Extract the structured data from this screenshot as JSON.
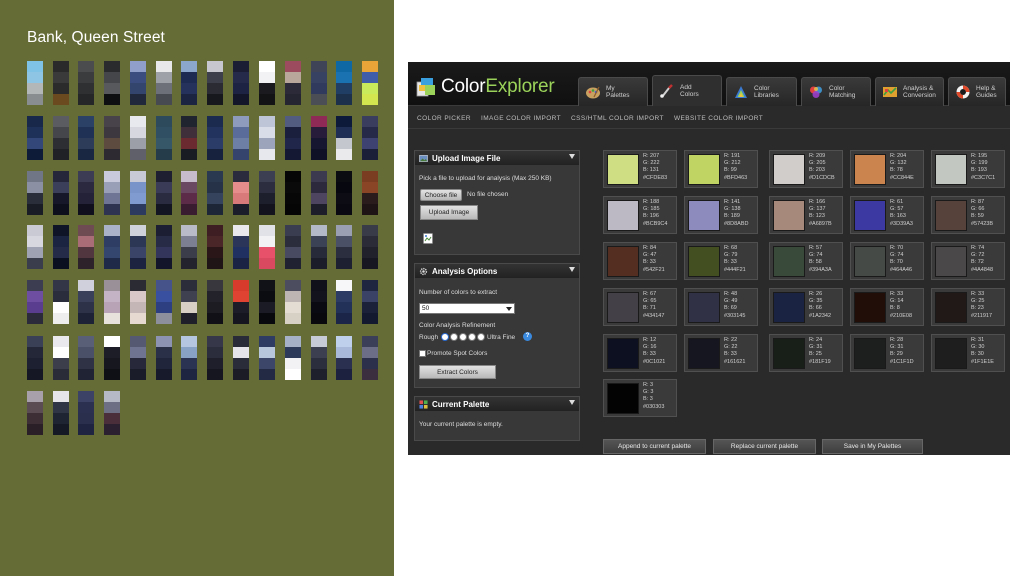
{
  "slide": {
    "title": "Bank, Queen Street",
    "background": "#666c36",
    "swatch_columns": [
      [
        "#7fc3e6",
        "#8fc5e4",
        "#b4b7b8",
        "#8a8d8f"
      ],
      [
        "#2a2a2a",
        "#3a3a3a",
        "#2b2b2b",
        "#6b4a1f"
      ],
      [
        "#4a4c4e",
        "#3b3c3e",
        "#2f3032",
        "#252627"
      ],
      [
        "#2a2b2d",
        "#45464a",
        "#58595c",
        "#0e0f10"
      ],
      [
        "#8f9fc9",
        "#3a4d7e",
        "#34456d",
        "#20283c"
      ],
      [
        "#e8e8ea",
        "#9fa1a8",
        "#6e7079",
        "#484a51"
      ],
      [
        "#8ca7cc",
        "#1d2b52",
        "#25335c",
        "#1b2542"
      ],
      [
        "#c6c7cf",
        "#3d3f4a",
        "#2a2b33",
        "#17181d"
      ],
      [
        "#1a1d33",
        "#252a4a",
        "#1d2342",
        "#131629"
      ],
      [
        "#ffffff",
        "#f2f2f4",
        "#1a1a1f",
        "#131316"
      ],
      [
        "#9c4a5e",
        "#b8a79a",
        "#2c2a38",
        "#252431"
      ],
      [
        "#3f4556",
        "#374161",
        "#2f3a5c",
        "#4b4e55"
      ],
      [
        "#0f68a4",
        "#1b72b0",
        "#203d63",
        "#1c2f4b"
      ],
      [
        "#e9a537",
        "#3f5da8",
        "#c9ea5a",
        "#d4e64f"
      ],
      [
        "#17284a",
        "#1e3158",
        "#334878",
        "#0e1b38"
      ],
      [
        "#5a5c62",
        "#44464c",
        "#2c2e33",
        "#1f2126"
      ],
      [
        "#2b4165",
        "#1f3154",
        "#2d3c58",
        "#1a2742"
      ],
      [
        "#48434b",
        "#3d3840",
        "#5e4b3f",
        "#2e2a31"
      ],
      [
        "#e8e9ee",
        "#d7d8df",
        "#9c9ea8",
        "#5f6069"
      ],
      [
        "#2d4a5c",
        "#304f62",
        "#355767",
        "#253c4a"
      ],
      [
        "#20242e",
        "#3e2f3a",
        "#6a2a30",
        "#1a1c24"
      ],
      [
        "#1b2a4f",
        "#22335e",
        "#2b3c69",
        "#17223f"
      ],
      [
        "#8f9bbd",
        "#5a6d9a",
        "#6e7fa6",
        "#34446c"
      ],
      [
        "#bdc5d6",
        "#d9dde7",
        "#9ba4ba",
        "#e6e8ed"
      ],
      [
        "#525b80",
        "#1b1f3e",
        "#20254a",
        "#151833"
      ],
      [
        "#8e2a55",
        "#271d3b",
        "#171630",
        "#0f1226"
      ],
      [
        "#0d1a3a",
        "#1f2e55",
        "#c5c7cf",
        "#eaeaec"
      ],
      [
        "#3a3d5e",
        "#262a48",
        "#3e4270",
        "#1c1f38"
      ],
      [
        "#707686",
        "#8b90a2",
        "#2a2d3a",
        "#1a1c25"
      ],
      [
        "#25263a",
        "#3c3f5a",
        "#161728",
        "#0e0f1c"
      ],
      [
        "#3d3c55",
        "#2a2940",
        "#232238",
        "#0f0f1e"
      ],
      [
        "#c9cadb",
        "#9a9fb8",
        "#6e7595",
        "#2d3350"
      ],
      [
        "#c8cad6",
        "#7994c8",
        "#7f9bd0",
        "#2c3a60"
      ],
      [
        "#1e1f30",
        "#3a3b56",
        "#2a2b40",
        "#141523"
      ],
      [
        "#c7bccb",
        "#6b4862",
        "#5c2b48",
        "#3a1c31"
      ],
      [
        "#2b3950",
        "#263248",
        "#36435c",
        "#1d2637"
      ],
      [
        "#2a2b3d",
        "#e58c8c",
        "#d97a7a",
        "#1c1d2a"
      ],
      [
        "#3c3e52",
        "#2c2e3f",
        "#1e1f2c",
        "#12131c"
      ],
      [
        "#060606",
        "#0a0a0a",
        "#070707",
        "#050505"
      ],
      [
        "#3c3a4e",
        "#2b293b",
        "#4e4560",
        "#1d1c29"
      ],
      [
        "#0b0b12",
        "#070710",
        "#0d0b14",
        "#0a0810"
      ],
      [
        "#7a3d22",
        "#8a4426",
        "#2a1b1c",
        "#1e1416"
      ],
      [
        "#c9cad3",
        "#d7d8df",
        "#9ea2b2",
        "#3a3e4c"
      ],
      [
        "#0f1426",
        "#1b2440",
        "#232b48",
        "#0b1020"
      ],
      [
        "#6e4a52",
        "#a86d76",
        "#52363f",
        "#2e222a"
      ],
      [
        "#a9b2c9",
        "#2d3d63",
        "#34466e",
        "#1e2a47"
      ],
      [
        "#d0d2db",
        "#2c3655",
        "#3a4468",
        "#1b2340"
      ],
      [
        "#1c1e33",
        "#282b45",
        "#33365a",
        "#13152a"
      ],
      [
        "#b9bbc9",
        "#7c7f91",
        "#3b3d4b",
        "#22232d"
      ],
      [
        "#3e1e22",
        "#4a2629",
        "#2a1619",
        "#1f1416"
      ],
      [
        "#e9e9ed",
        "#2b3459",
        "#203061",
        "#1a2344"
      ],
      [
        "#e1e2e8",
        "#f2f2f4",
        "#e7526a",
        "#d94a60"
      ],
      [
        "#3a3c4f",
        "#2b2d3d",
        "#474a60",
        "#202231"
      ],
      [
        "#b4b9c8",
        "#3c4256",
        "#272a38",
        "#1b1d28"
      ],
      [
        "#9aa0b2",
        "#4a5066",
        "#2a2e3e",
        "#1d2030"
      ],
      [
        "#3a3b49",
        "#2a2b37",
        "#20212b",
        "#161720"
      ],
      [
        "#3d3d52",
        "#6e4ea0",
        "#5b3d8f",
        "#2a2a3a"
      ],
      [
        "#323646",
        "#2a2d3b",
        "#ffffff",
        "#eeeeee"
      ],
      [
        "#cfd0db",
        "#3a3f5a",
        "#2d3249",
        "#1e2236"
      ],
      [
        "#9a9098",
        "#c4b3c5",
        "#b7a3b5",
        "#e8e2dc"
      ],
      [
        "#2a2b33",
        "#d9c8c8",
        "#c4b5b6",
        "#e5d9d2"
      ],
      [
        "#46538a",
        "#3950a0",
        "#2d3f80",
        "#8d8f9d"
      ],
      [
        "#2c2d3a",
        "#3f4050",
        "#d8cfc5",
        "#1e1f28"
      ],
      [
        "#39373e",
        "#23222a",
        "#1d1c23",
        "#111016"
      ],
      [
        "#d83a2b",
        "#e04332",
        "#1b1c28",
        "#14151e"
      ],
      [
        "#111218",
        "#0b0c12",
        "#1a1b24",
        "#08090d"
      ],
      [
        "#4c4d5e",
        "#bcb5b4",
        "#e3ddd3",
        "#d7d0c4"
      ],
      [
        "#0f1019",
        "#12131c",
        "#0a0b12",
        "#08080d"
      ],
      [
        "#f7f7f9",
        "#2b3b63",
        "#223158",
        "#1a2547"
      ],
      [
        "#1e2640",
        "#3a4366",
        "#1a2139",
        "#131a30"
      ],
      [
        "#3a4056",
        "#232737",
        "#1d2030",
        "#151824"
      ],
      [
        "#eaeaee",
        "#ffffff",
        "#3c3e4c",
        "#2a2c38"
      ],
      [
        "#5a5f78",
        "#4b5069",
        "#2f3245",
        "#202333"
      ],
      [
        "#ffffff",
        "#1c1d26",
        "#16171f",
        "#0f1016"
      ],
      [
        "#555a72",
        "#6f7590",
        "#27293a",
        "#1b1c29"
      ],
      [
        "#8d94b3",
        "#2a3048",
        "#20253b",
        "#161a2b"
      ],
      [
        "#b5c6e0",
        "#88a2c6",
        "#2a3352",
        "#1e2540"
      ],
      [
        "#36384a",
        "#2b2d3c",
        "#1e1f2b",
        "#15161f"
      ],
      [
        "#2a2b38",
        "#e4e4ea",
        "#2b2c3a",
        "#1b1c26"
      ],
      [
        "#2e3b62",
        "#b9c7dd",
        "#3b4668",
        "#232a44"
      ],
      [
        "#a6b1c8",
        "#2d3a5a",
        "#f2f2f4",
        "#ffffff"
      ],
      [
        "#c7cbd8",
        "#3b3f50",
        "#2b2e3c",
        "#1e202b"
      ],
      [
        "#bfd0ec",
        "#a9b9d9",
        "#2a3150",
        "#1c2140"
      ],
      [
        "#3c3f58",
        "#6b6e86",
        "#2d304b",
        "#3b2e3f"
      ],
      [
        "#a8a0ab",
        "#5b4b52",
        "#3d2e36",
        "#2a1f26"
      ],
      [
        "#e6e6ea",
        "#2f3545",
        "#1f2432",
        "#151925"
      ],
      [
        "#3c4266",
        "#2b3050",
        "#2a2f4d",
        "#1f2440"
      ],
      [
        "#b5b8c5",
        "#6d7085",
        "#4a2f3a",
        "#2a2030"
      ]
    ]
  },
  "app": {
    "logo": {
      "part1": "Color",
      "part2": "Explorer"
    },
    "tabs": [
      {
        "label": "My\nPalettes",
        "icon": "palette-icon",
        "active": false
      },
      {
        "label": "Add\nColors",
        "icon": "brush-icon",
        "active": true
      },
      {
        "label": "Color\nLibraries",
        "icon": "library-icon",
        "active": false
      },
      {
        "label": "Color\nMatching",
        "icon": "color-wheel-icon",
        "active": false
      },
      {
        "label": "Analysis &\nConversion",
        "icon": "analysis-icon",
        "active": false
      },
      {
        "label": "Help &\nGuides",
        "icon": "lifebuoy-icon",
        "active": false
      }
    ],
    "subnav": [
      "COLOR PICKER",
      "IMAGE COLOR IMPORT",
      "CSS/HTML COLOR IMPORT",
      "WEBSITE COLOR IMPORT"
    ],
    "upload_panel": {
      "title": "Upload Image File",
      "instructions": "Pick a file to upload for analysis (Max 250 KB)",
      "choose_file": "Choose file",
      "no_file": "No file chosen",
      "upload_button": "Upload Image"
    },
    "analysis_panel": {
      "title": "Analysis Options",
      "colors_label": "Number of colors to extract",
      "colors_value": "50",
      "refinement_label": "Color Analysis Refinement",
      "rough": "Rough",
      "ultra_fine": "Ultra Fine",
      "promote_label": "Promote Spot Colors",
      "extract_button": "Extract Colors"
    },
    "palette_panel": {
      "title": "Current Palette",
      "empty_text": "Your current palette is empty."
    },
    "colors": [
      {
        "r": "R: 207",
        "g": "G: 222",
        "b": "B: 131",
        "hex": "#CFDE83",
        "color": "#cfde83"
      },
      {
        "r": "R: 191",
        "g": "G: 212",
        "b": "B: 99",
        "hex": "#BFD463",
        "color": "#bfd463"
      },
      {
        "r": "R: 209",
        "g": "G: 205",
        "b": "B: 203",
        "hex": "#D1CDCB",
        "color": "#d1cdcb"
      },
      {
        "r": "R: 204",
        "g": "G: 132",
        "b": "B: 78",
        "hex": "#CC844E",
        "color": "#cc844e"
      },
      {
        "r": "R: 195",
        "g": "G: 199",
        "b": "B: 193",
        "hex": "#C3C7C1",
        "color": "#c3c7c1"
      },
      {
        "r": "R: 188",
        "g": "G: 185",
        "b": "B: 196",
        "hex": "#BCB9C4",
        "color": "#bcb9c4"
      },
      {
        "r": "R: 141",
        "g": "G: 138",
        "b": "B: 189",
        "hex": "#8D8ABD",
        "color": "#8d8abd"
      },
      {
        "r": "R: 166",
        "g": "G: 137",
        "b": "B: 123",
        "hex": "#A6897B",
        "color": "#a6897b"
      },
      {
        "r": "R: 61",
        "g": "G: 57",
        "b": "B: 163",
        "hex": "#3D39A3",
        "color": "#3d39a3"
      },
      {
        "r": "R: 87",
        "g": "G: 66",
        "b": "B: 59",
        "hex": "#57423B",
        "color": "#57423b"
      },
      {
        "r": "R: 84",
        "g": "G: 47",
        "b": "B: 33",
        "hex": "#542F21",
        "color": "#542f21"
      },
      {
        "r": "R: 68",
        "g": "G: 79",
        "b": "B: 33",
        "hex": "#444F21",
        "color": "#444f21"
      },
      {
        "r": "R: 57",
        "g": "G: 74",
        "b": "B: 58",
        "hex": "#394A3A",
        "color": "#394a3a"
      },
      {
        "r": "R: 70",
        "g": "G: 74",
        "b": "B: 70",
        "hex": "#464A46",
        "color": "#464a46"
      },
      {
        "r": "R: 74",
        "g": "G: 72",
        "b": "B: 72",
        "hex": "#4A4848",
        "color": "#4a4848"
      },
      {
        "r": "R: 67",
        "g": "G: 65",
        "b": "B: 71",
        "hex": "#434147",
        "color": "#434147"
      },
      {
        "r": "R: 48",
        "g": "G: 49",
        "b": "B: 69",
        "hex": "#303145",
        "color": "#303145"
      },
      {
        "r": "R: 26",
        "g": "G: 35",
        "b": "B: 66",
        "hex": "#1A2342",
        "color": "#1a2342"
      },
      {
        "r": "R: 33",
        "g": "G: 14",
        "b": "B: 8",
        "hex": "#210E08",
        "color": "#210e08"
      },
      {
        "r": "R: 33",
        "g": "G: 25",
        "b": "B: 23",
        "hex": "#211917",
        "color": "#211917"
      },
      {
        "r": "R: 12",
        "g": "G: 16",
        "b": "B: 33",
        "hex": "#0C1021",
        "color": "#0c1021"
      },
      {
        "r": "R: 22",
        "g": "G: 22",
        "b": "B: 33",
        "hex": "#161621",
        "color": "#161621"
      },
      {
        "r": "R: 24",
        "g": "G: 31",
        "b": "B: 25",
        "hex": "#181F19",
        "color": "#181f19"
      },
      {
        "r": "R: 28",
        "g": "G: 31",
        "b": "B: 29",
        "hex": "#1C1F1D",
        "color": "#1c1f1d"
      },
      {
        "r": "R: 31",
        "g": "G: 30",
        "b": "B: 30",
        "hex": "#1F1E1E",
        "color": "#1f1e1e"
      },
      {
        "r": "R: 3",
        "g": "G: 3",
        "b": "B: 3",
        "hex": "#030303",
        "color": "#030303"
      }
    ],
    "bottom_buttons": [
      "Append to current palette",
      "Replace current palette",
      "Save in My Palettes"
    ]
  }
}
